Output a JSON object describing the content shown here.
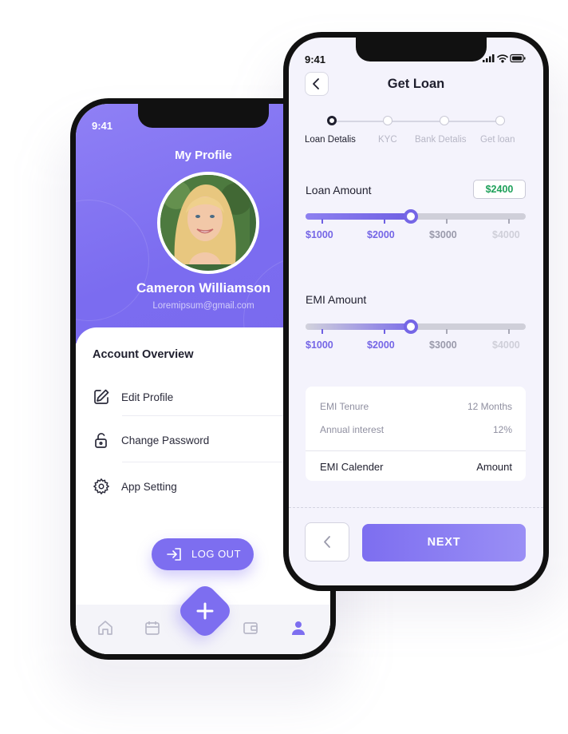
{
  "profile_screen": {
    "status_time": "9:41",
    "title": "My Profile",
    "user_name": "Cameron Williamson",
    "user_email": "Loremipsum@gmail.com",
    "section_title": "Account Overview",
    "menu_items": [
      {
        "label": "Edit Profile",
        "icon": "edit-icon"
      },
      {
        "label": "Change Password",
        "icon": "lock-icon"
      },
      {
        "label": "App Setting",
        "icon": "gear-icon"
      }
    ],
    "logout_label": "LOG OUT",
    "tabs": [
      "home-icon",
      "calendar-icon",
      "wallet-icon",
      "user-icon"
    ],
    "accent": "#7d6ef0"
  },
  "loan_screen": {
    "status_time": "9:41",
    "title": "Get Loan",
    "steps": [
      "Loan Detalis",
      "KYC",
      "Bank Detalis",
      "Get loan"
    ],
    "active_step": 0,
    "loan_amount": {
      "label": "Loan Amount",
      "value": "$2400",
      "ticks": [
        "$1000",
        "$2000",
        "$3000",
        "$4000"
      ],
      "fraction": 0.48
    },
    "emi_amount": {
      "label": "EMI Amount",
      "ticks": [
        "$1000",
        "$2000",
        "$3000",
        "$4000"
      ],
      "fraction": 0.48
    },
    "summary": {
      "rows": [
        {
          "label": "EMI Tenure",
          "value": "12 Months"
        },
        {
          "label": "Annual interest",
          "value": "12%"
        }
      ],
      "footer": {
        "label": "EMI Calender",
        "value": "Amount"
      }
    },
    "next_label": "NEXT",
    "accent": "#7566e6",
    "positive_color": "#1ea05a"
  }
}
